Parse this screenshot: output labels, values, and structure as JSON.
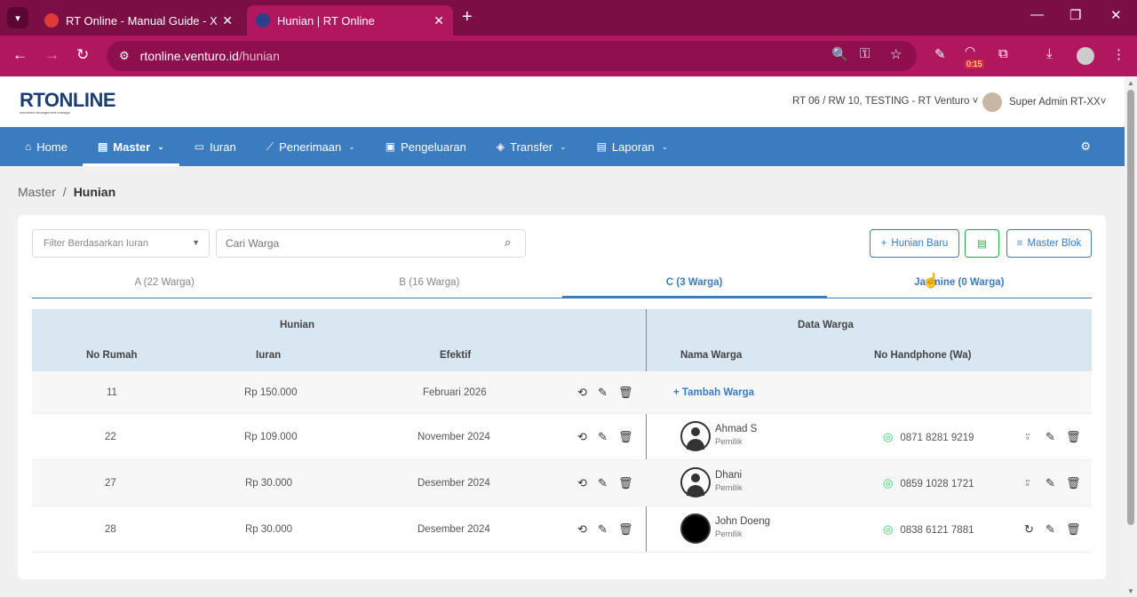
{
  "browser": {
    "tabs": [
      {
        "title": "RT Online - Manual Guide - Xm",
        "active": false
      },
      {
        "title": "Hunian | RT Online",
        "active": true
      }
    ],
    "url_host": "rtonline.venturo.id",
    "url_path": "/hunian",
    "ext_badge": "0:15"
  },
  "header": {
    "logo_text": "RTONLINE",
    "logo_sub": "wonderful arrangement manage",
    "rt_select": "RT 06 / RW 10, TESTING - RT Venturo",
    "user_name": "Super Admin RT-XX"
  },
  "nav": {
    "items": [
      {
        "label": "Home",
        "icon": "home-icon"
      },
      {
        "label": "Master",
        "icon": "file-icon"
      },
      {
        "label": "Iuran",
        "icon": "card-icon"
      },
      {
        "label": "Penerimaan",
        "icon": "chart-icon"
      },
      {
        "label": "Pengeluaran",
        "icon": "receipt-icon"
      },
      {
        "label": "Transfer",
        "icon": "tag-icon"
      },
      {
        "label": "Laporan",
        "icon": "doc-icon"
      }
    ]
  },
  "breadcrumb": {
    "parent": "Master",
    "current": "Hunian"
  },
  "toolbar": {
    "filter_placeholder": "Filter Berdasarkan Iuran",
    "search_placeholder": "Cari Warga",
    "new_button": "Hunian Baru",
    "master_blok_button": "Master Blok"
  },
  "blok_tabs": [
    {
      "label": "A (22 Warga)"
    },
    {
      "label": "B (16 Warga)"
    },
    {
      "label": "C (3 Warga)"
    },
    {
      "label": "Jasmine (0 Warga)"
    }
  ],
  "table": {
    "group_hunian": "Hunian",
    "group_warga": "Data Warga",
    "columns": {
      "no": "No Rumah",
      "iuran": "Iuran",
      "efektif": "Efektif",
      "nama": "Nama Warga",
      "hp": "No Handphone (Wa)"
    },
    "tambah_label": "Tambah Warga",
    "rows": [
      {
        "no": "11",
        "iuran": "Rp 150.000",
        "efektif": "Februari 2026",
        "nama": "",
        "role": "",
        "hp": ""
      },
      {
        "no": "22",
        "iuran": "Rp 109.000",
        "efektif": "November 2024",
        "nama": "Ahmad S",
        "role": "Pemilik",
        "hp": "0871 8281 9219"
      },
      {
        "no": "27",
        "iuran": "Rp 30.000",
        "efektif": "Desember 2024",
        "nama": "Dhani",
        "role": "Pemilik",
        "hp": "0859 1028 1721"
      },
      {
        "no": "28",
        "iuran": "Rp 30.000",
        "efektif": "Desember 2024",
        "nama": "John Doeng",
        "role": "Pemilik",
        "hp": "0838 6121 7881"
      }
    ]
  },
  "colors": {
    "brand": "#3b7bbf",
    "chrome": "#b0175f",
    "whatsapp": "#25d366"
  }
}
